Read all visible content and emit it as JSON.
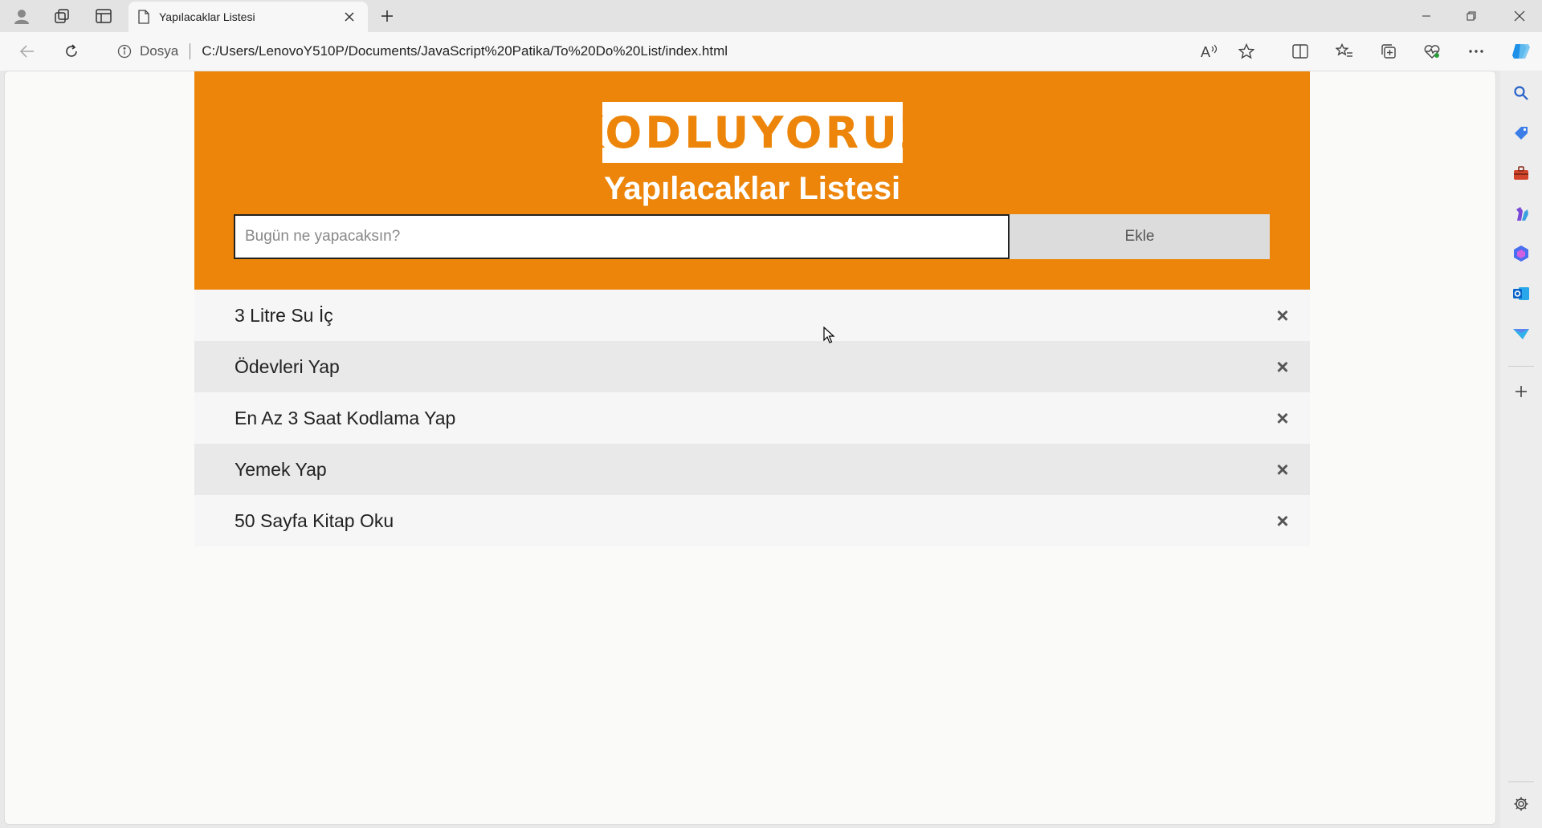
{
  "browser": {
    "tab_title": "Yapılacaklar Listesi",
    "site_info_label": "Dosya",
    "url": "C:/Users/LenovoY510P/Documents/JavaScript%20Patika/To%20Do%20List/index.html",
    "read_aloud_label": "A",
    "sidebar_icons": [
      "search-icon",
      "shopping-tag-icon",
      "tools-icon",
      "games-icon",
      "microsoft365-icon",
      "outlook-icon",
      "drop-icon"
    ]
  },
  "app": {
    "logo_text": "KODLUYORUZ",
    "title": "Yapılacaklar Listesi",
    "input_placeholder": "Bugün ne yapacaksın?",
    "add_label": "Ekle",
    "delete_symbol": "×",
    "items": [
      {
        "text": "3 Litre Su İç"
      },
      {
        "text": "Ödevleri Yap"
      },
      {
        "text": "En Az 3 Saat Kodlama Yap"
      },
      {
        "text": "Yemek Yap"
      },
      {
        "text": "50 Sayfa Kitap Oku"
      }
    ]
  },
  "colors": {
    "header_orange": "#ec850a",
    "list_odd": "#f6f6f6",
    "list_even": "#e9e9e9"
  }
}
